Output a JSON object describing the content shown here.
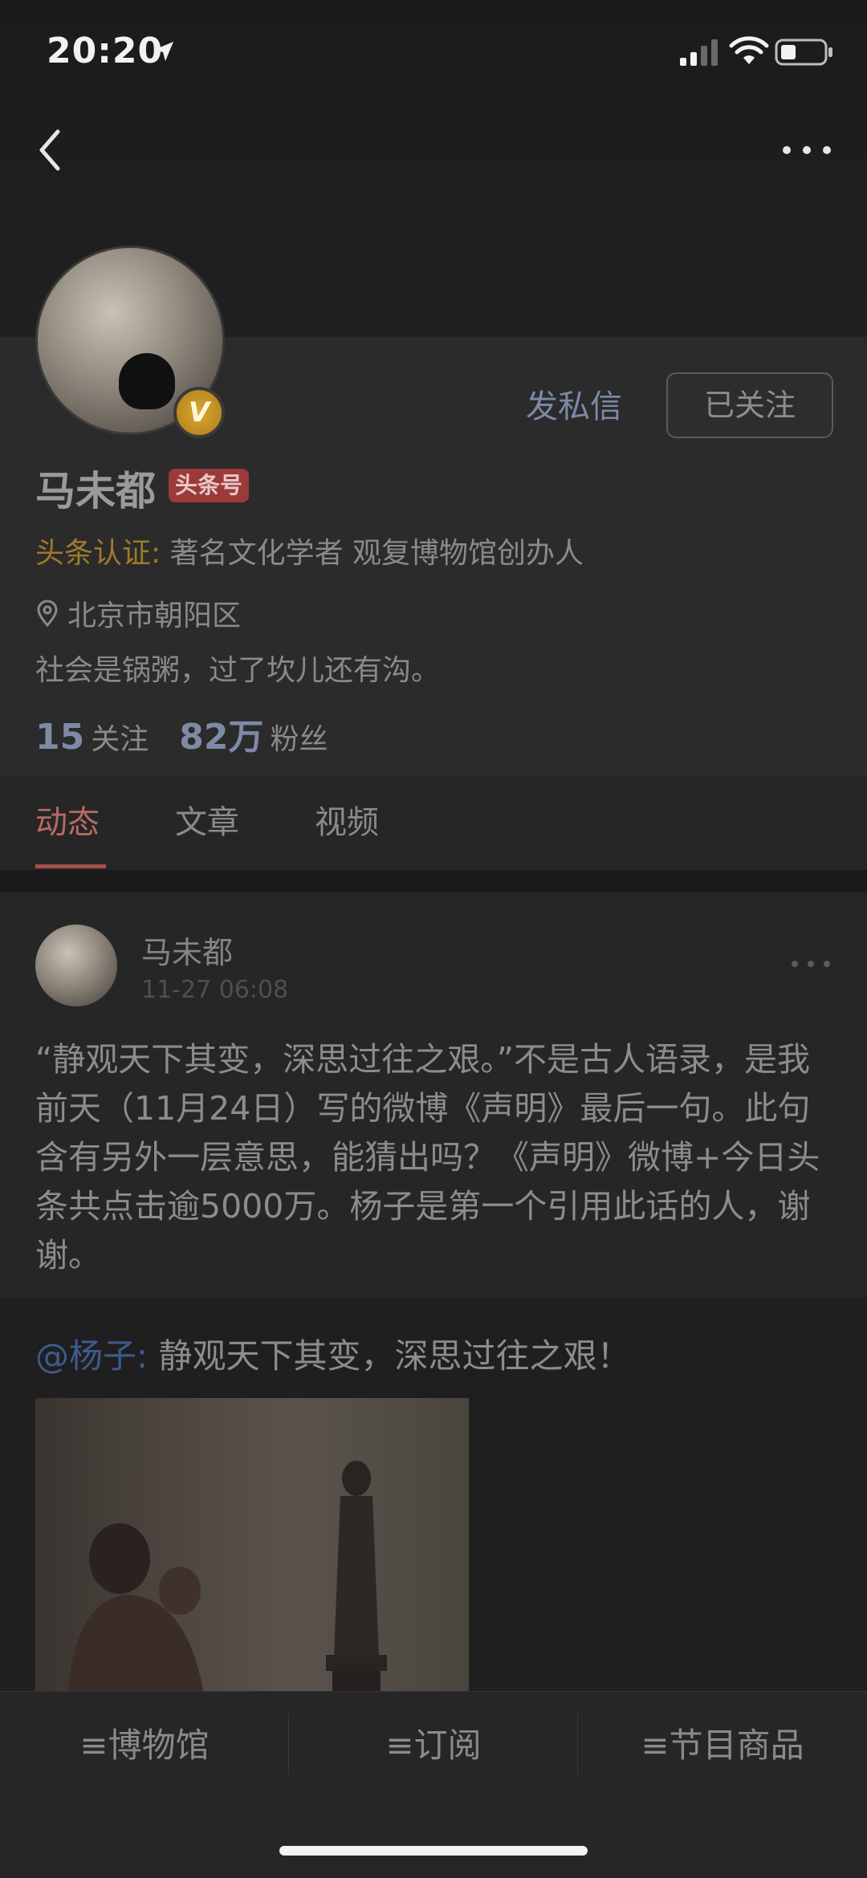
{
  "status_bar": {
    "time": "20:20"
  },
  "profile": {
    "dm_label": "发私信",
    "follow_label": "已关注",
    "name": "马未都",
    "tag": "头条号",
    "verify_label": "头条认证:",
    "verify_text": " 著名文化学者 观复博物馆创办人",
    "location": "北京市朝阳区",
    "bio": "社会是锅粥，过了坎儿还有沟。",
    "following_count": "15",
    "following_label": "关注",
    "followers_count": "82万",
    "followers_label": "粉丝"
  },
  "tabs": [
    {
      "label": "动态"
    },
    {
      "label": "文章"
    },
    {
      "label": "视频"
    }
  ],
  "post": {
    "author": "马未都",
    "time": "11-27 06:08",
    "text": "“静观天下其变，深思过往之艰。”不是古人语录，是我前天（11月24日）写的微博《声明》最后一句。此句含有另外一层意思，能猜出吗？《声明》微博+今日头条共点击逾5000万。杨子是第一个引用此话的人，谢谢。",
    "repost_mention": "@杨子:",
    "repost_text": " 静观天下其变，深思过往之艰！"
  },
  "bottom_nav": [
    {
      "label": "≡博物馆"
    },
    {
      "label": "≡订阅"
    },
    {
      "label": "≡节目商品"
    }
  ],
  "icons": {
    "back": "chevron-left-icon",
    "more": "more-dots-icon",
    "location": "pin-icon",
    "verified": "v-badge-icon"
  },
  "colors": {
    "accent": "#a7504a",
    "link": "#3d5b8a",
    "verify": "#9d7b2a"
  }
}
